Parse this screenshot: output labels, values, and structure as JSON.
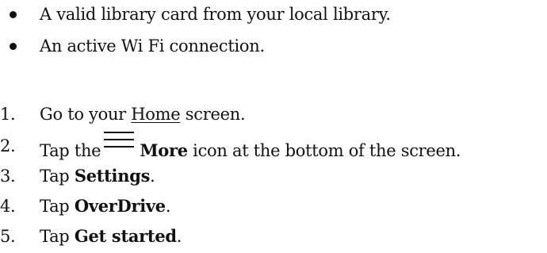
{
  "requirements": [
    "A valid library card from your local library.",
    "An active Wi Fi connection."
  ],
  "steps": [
    {
      "number": "1.",
      "pre": "Go to your ",
      "underlined": "Home",
      "post": " screen."
    },
    {
      "number": "2.",
      "pre": "Tap the",
      "icon": "more-icon",
      "bold": "More",
      "post": " icon at the bottom of the screen."
    },
    {
      "number": "3.",
      "pre": "Tap ",
      "bold": "Settings",
      "post": "."
    },
    {
      "number": "4.",
      "pre": "Tap ",
      "bold": "OverDrive",
      "post": "."
    },
    {
      "number": "5.",
      "pre": "Tap ",
      "bold": "Get started",
      "post": "."
    }
  ]
}
